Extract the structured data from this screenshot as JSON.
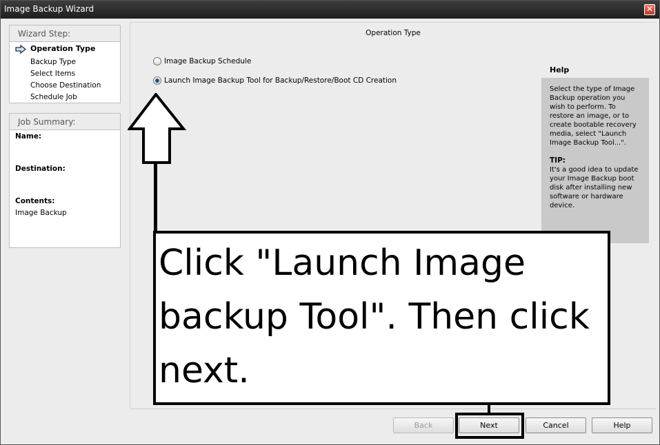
{
  "window": {
    "title": "Image Backup Wizard",
    "close_glyph": "✕"
  },
  "wizard": {
    "heading": "Wizard Step:",
    "steps": [
      {
        "label": "Operation Type",
        "active": true
      },
      {
        "label": "Backup Type"
      },
      {
        "label": "Select Items"
      },
      {
        "label": "Choose Destination"
      },
      {
        "label": "Schedule Job"
      }
    ]
  },
  "summary": {
    "heading": "Job Summary:",
    "name_label": "Name:",
    "destination_label": "Destination:",
    "contents_label": "Contents:",
    "contents_value": "Image Backup"
  },
  "main": {
    "title": "Operation Type",
    "options": [
      {
        "label": "Image Backup Schedule",
        "checked": false
      },
      {
        "label": "Launch Image Backup Tool for Backup/Restore/Boot CD Creation",
        "checked": true
      }
    ]
  },
  "help": {
    "heading": "Help",
    "body": "Select the type of Image Backup operation you wish to perform.  To restore an image, or to create bootable recovery media, select \"Launch Image Backup Tool...\".",
    "tip_heading": "TIP:",
    "tip_body": "It's a good idea to update your Image Backup boot disk after installing new software or hardware device."
  },
  "annotation": {
    "text": "Click \"Launch Image backup Tool\". Then click next."
  },
  "buttons": {
    "back": "Back",
    "next": "Next",
    "cancel": "Cancel",
    "help": "Help"
  }
}
